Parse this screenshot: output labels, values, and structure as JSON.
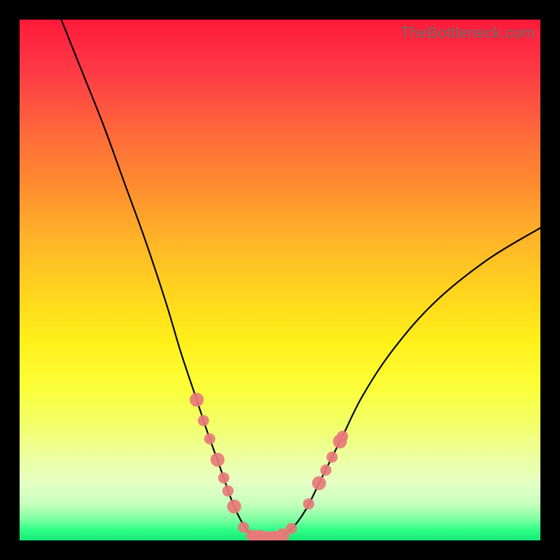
{
  "watermark": "TheBottleneck.com",
  "chart_data": {
    "type": "line",
    "title": "",
    "xlabel": "",
    "ylabel": "",
    "xlim": [
      0,
      100
    ],
    "ylim": [
      0,
      100
    ],
    "series": [
      {
        "name": "bottleneck-curve",
        "x": [
          8,
          12,
          16,
          20,
          24,
          28,
          31,
          34,
          36,
          38.5,
          41,
          43,
          45,
          47,
          49.5,
          52,
          55,
          58,
          62,
          66,
          72,
          80,
          90,
          100
        ],
        "y": [
          100,
          90,
          80,
          69,
          58,
          46,
          36,
          27,
          21,
          14,
          7,
          3,
          0.8,
          0.6,
          0.8,
          2,
          6,
          12,
          20,
          28,
          37,
          46,
          54,
          60
        ]
      }
    ],
    "markers": {
      "name": "highlighted-points",
      "color": "#e77a7a",
      "points": [
        {
          "x": 34.0,
          "y": 27.0
        },
        {
          "x": 35.3,
          "y": 23.0
        },
        {
          "x": 36.5,
          "y": 19.5
        },
        {
          "x": 38.0,
          "y": 15.5
        },
        {
          "x": 39.2,
          "y": 12.0
        },
        {
          "x": 40.0,
          "y": 9.5
        },
        {
          "x": 41.2,
          "y": 6.5
        },
        {
          "x": 43.0,
          "y": 2.5
        },
        {
          "x": 44.5,
          "y": 1.0
        },
        {
          "x": 46.0,
          "y": 0.7
        },
        {
          "x": 47.5,
          "y": 0.6
        },
        {
          "x": 49.0,
          "y": 0.7
        },
        {
          "x": 50.5,
          "y": 1.0
        },
        {
          "x": 52.2,
          "y": 2.3
        },
        {
          "x": 55.5,
          "y": 7.0
        },
        {
          "x": 57.5,
          "y": 11.0
        },
        {
          "x": 58.8,
          "y": 13.5
        },
        {
          "x": 60.0,
          "y": 16.0
        },
        {
          "x": 61.5,
          "y": 19.0
        },
        {
          "x": 62.0,
          "y": 20.0
        }
      ]
    },
    "gradient_stops": [
      {
        "pos": 0,
        "color": "#ff1a3a"
      },
      {
        "pos": 50,
        "color": "#ffd31e"
      },
      {
        "pos": 80,
        "color": "#f2ff6b"
      },
      {
        "pos": 100,
        "color": "#16e878"
      }
    ]
  }
}
